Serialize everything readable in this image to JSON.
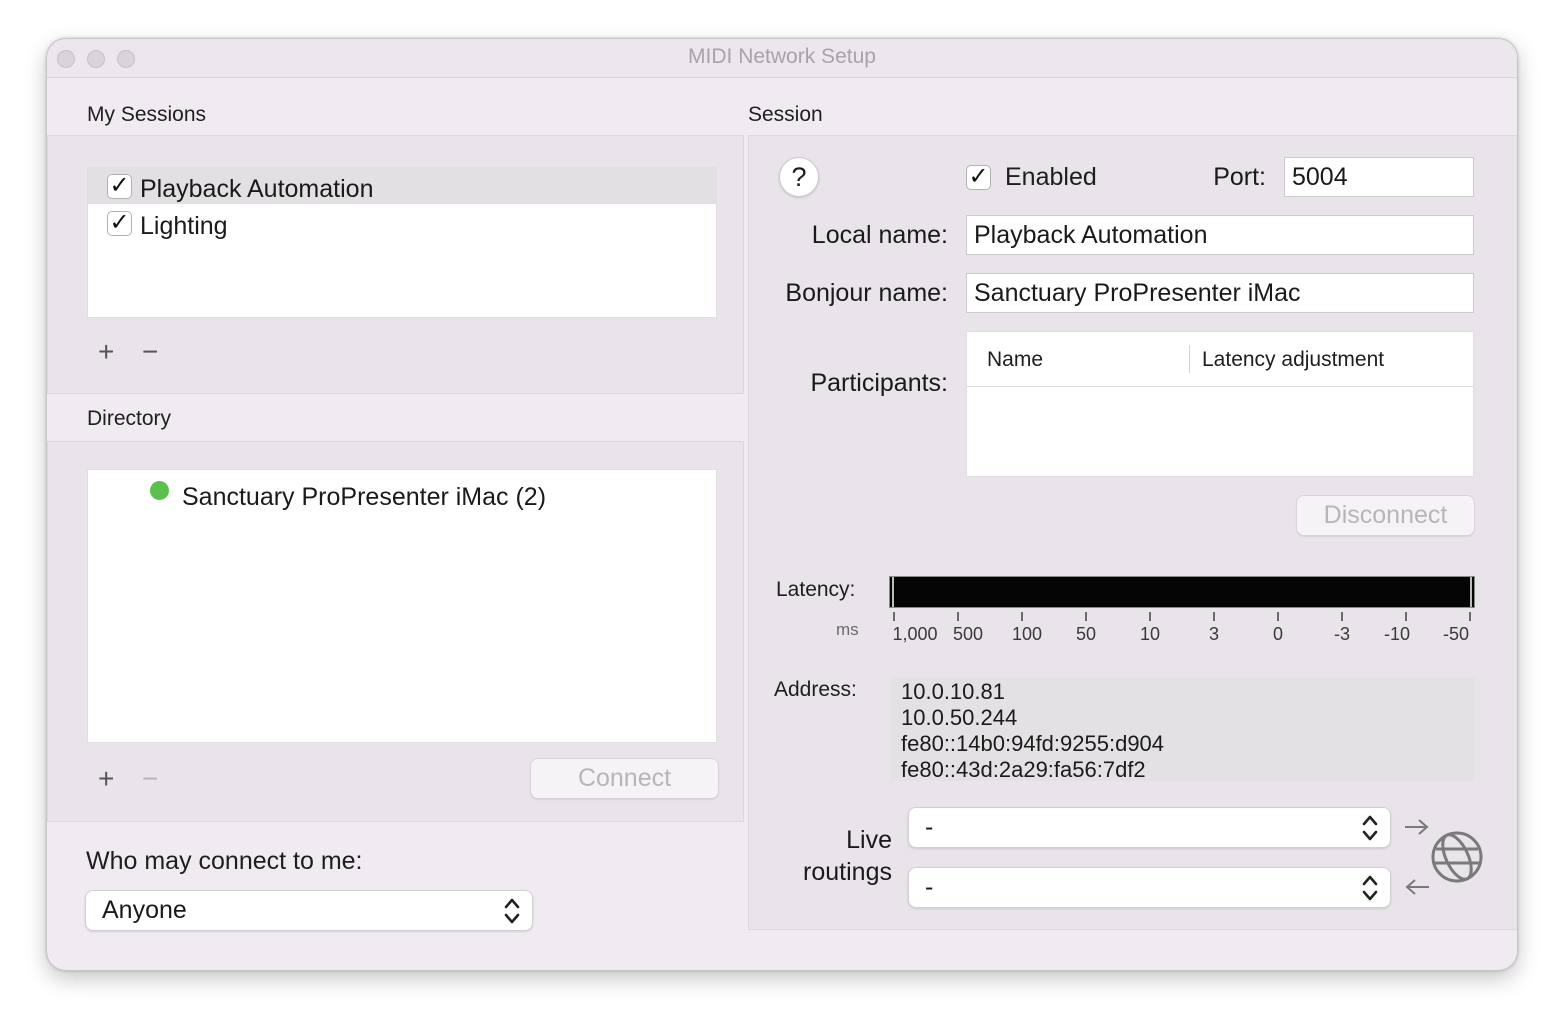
{
  "window": {
    "title": "MIDI Network Setup"
  },
  "my_sessions": {
    "heading": "My Sessions",
    "items": [
      {
        "label": "Playback Automation",
        "checked": true,
        "selected": true
      },
      {
        "label": "Lighting",
        "checked": true,
        "selected": false
      }
    ],
    "add_label": "+",
    "remove_label": "−"
  },
  "directory": {
    "heading": "Directory",
    "items": [
      {
        "label": "Sanctuary ProPresenter iMac (2)",
        "status_color": "#5cc04e"
      }
    ],
    "add_label": "+",
    "remove_label": "−",
    "connect_label": "Connect"
  },
  "who_may_connect": {
    "label": "Who may connect to me:",
    "value": "Anyone"
  },
  "session": {
    "heading": "Session",
    "help_label": "?",
    "enabled_label": "Enabled",
    "enabled": true,
    "port_label": "Port:",
    "port_value": "5004",
    "local_name_label": "Local name:",
    "local_name_value": "Playback Automation",
    "bonjour_name_label": "Bonjour name:",
    "bonjour_name_value": "Sanctuary ProPresenter iMac",
    "participants_label": "Participants:",
    "participants_columns": [
      "Name",
      "Latency adjustment"
    ],
    "disconnect_label": "Disconnect",
    "latency_label": "Latency:",
    "latency_unit": "ms",
    "latency_ticks": [
      "1,000",
      "500",
      "100",
      "50",
      "10",
      "3",
      "0",
      "-3",
      "-10",
      "-50"
    ],
    "address_label": "Address:",
    "addresses": [
      "10.0.10.81",
      "10.0.50.244",
      "fe80::14b0:94fd:9255:d904",
      "fe80::43d:2a29:fa56:7df2"
    ],
    "live_routings_label_1": "Live",
    "live_routings_label_2": "routings",
    "routing_out_value": "-",
    "routing_in_value": "-"
  }
}
